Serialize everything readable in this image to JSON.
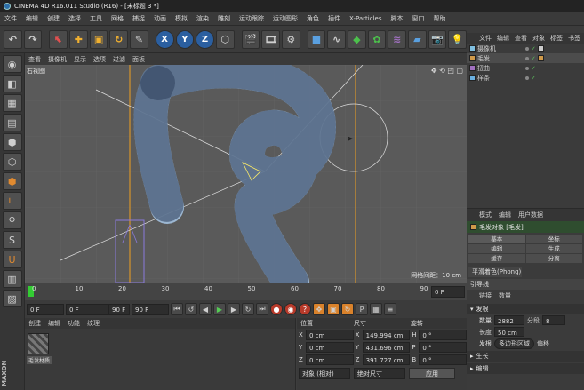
{
  "window": {
    "title": "CINEMA 4D R16.011 Studio (R16) - [未标题 3 *]"
  },
  "menu": [
    "文件",
    "编辑",
    "创建",
    "选择",
    "工具",
    "网格",
    "捕捉",
    "动画",
    "模拟",
    "渲染",
    "雕刻",
    "运动跟踪",
    "运动图形",
    "角色",
    "插件",
    "X-Particles",
    "脚本",
    "窗口",
    "帮助"
  ],
  "toolbar": {
    "undo_icon": "undo-icon",
    "axes": [
      "X",
      "Y",
      "Z"
    ]
  },
  "viewport": {
    "menu": [
      "查看",
      "摄像机",
      "显示",
      "选项",
      "过滤",
      "面板"
    ],
    "label": "右视图",
    "grid_info": "网格间距：10 cm"
  },
  "timeline": {
    "ticks": [
      "0",
      "10",
      "20",
      "30",
      "40",
      "50",
      "60",
      "70",
      "80",
      "90"
    ],
    "end_frame": "0 F"
  },
  "playback": {
    "start": "0 F",
    "current": "0 F",
    "current2": "90 F",
    "end": "90 F"
  },
  "materials": {
    "menu": [
      "创建",
      "编辑",
      "功能",
      "纹理"
    ],
    "material_name": "毛发材质"
  },
  "coordinates": {
    "headers": [
      "位置",
      "尺寸",
      "旋转"
    ],
    "rows": [
      {
        "axis": "X",
        "pos": "0 cm",
        "size_axis": "X",
        "size": "149.994 cm",
        "rot_axis": "H",
        "rot": "0 °"
      },
      {
        "axis": "Y",
        "pos": "0 cm",
        "size_axis": "Y",
        "size": "431.696 cm",
        "rot_axis": "P",
        "rot": "0 °"
      },
      {
        "axis": "Z",
        "pos": "0 cm",
        "size_axis": "Z",
        "size": "391.727 cm",
        "rot_axis": "B",
        "rot": "0 °"
      }
    ],
    "mode": "对象 (相对)",
    "size_mode": "绝对尺寸",
    "apply": "应用"
  },
  "objects": {
    "tabs": [
      "文件",
      "编辑",
      "查看",
      "对象",
      "标签",
      "书签"
    ],
    "items": [
      {
        "name": "摄像机",
        "color": "#7fbfe0"
      },
      {
        "name": "毛发",
        "color": "#d09a4a"
      },
      {
        "name": "扭曲",
        "color": "#a070c0"
      },
      {
        "name": "样条",
        "color": "#6ab0e0"
      }
    ]
  },
  "attributes": {
    "tabs": [
      "模式",
      "编辑",
      "用户数据"
    ],
    "object_title": "毛发对象 [毛发]",
    "buttons": [
      "基本",
      "坐标",
      "编辑",
      "生成",
      "缓存",
      "分离"
    ],
    "shading": "平滑着色(Phong)",
    "guides_header": "引导线",
    "sub_tabs": [
      "链接",
      "数量"
    ],
    "section_hair": "发根",
    "count_label": "数量",
    "count": "2882",
    "segments_label": "分段",
    "segments": "8",
    "length_label": "长度",
    "length": "50 cm",
    "root_label": "发根",
    "root": "多边形区域",
    "offset_label": "偏移",
    "section_grow": "生长",
    "section_edit": "编辑"
  },
  "colors": {
    "accent": "#2b5fa0",
    "hair": "#a8c8e8",
    "guide": "#f0a020"
  }
}
